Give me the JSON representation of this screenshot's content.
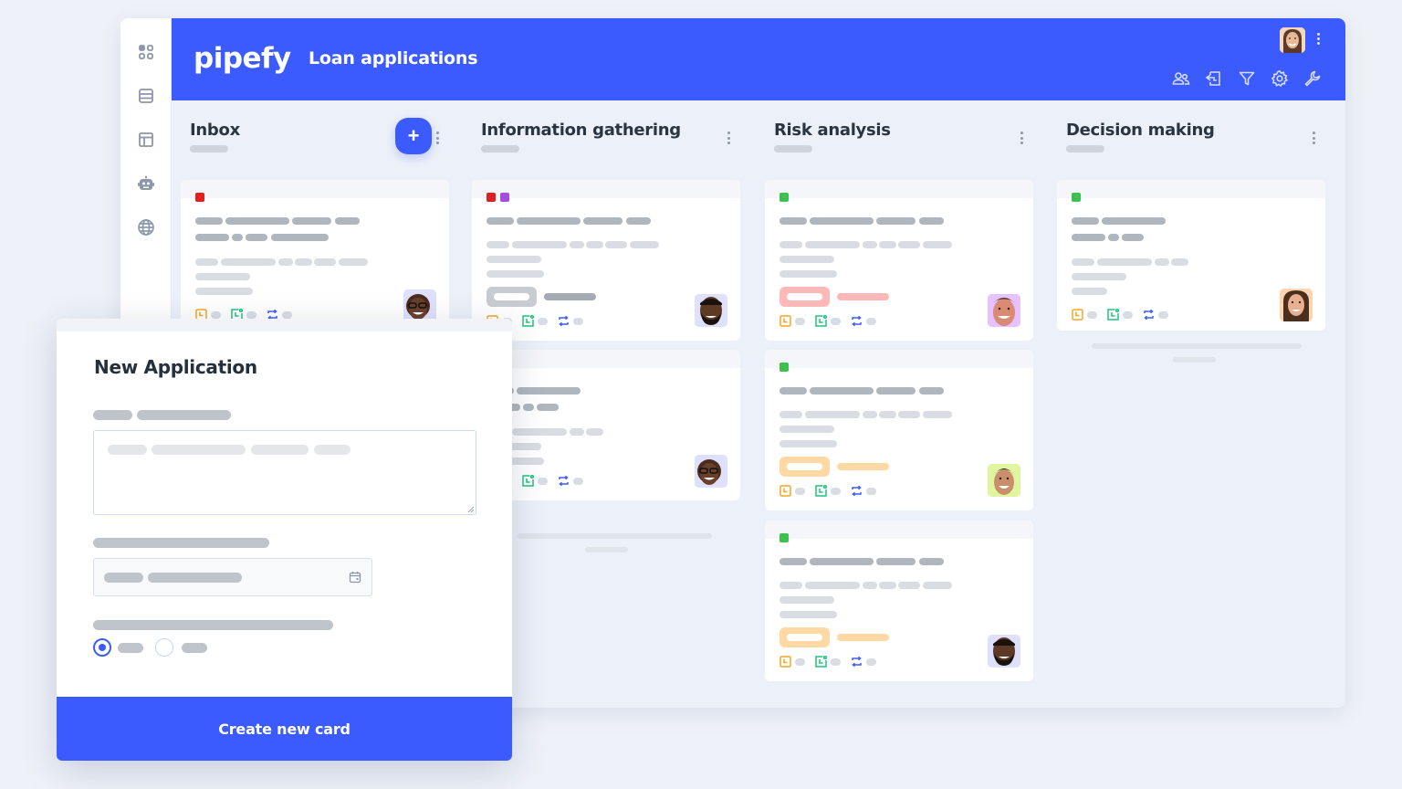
{
  "app": {
    "logo": "pipefy",
    "title": "Loan applications"
  },
  "sidebar": {
    "items": [
      {
        "icon": "dashboard-grid-icon",
        "label": "Dashboard"
      },
      {
        "icon": "database-icon",
        "label": "Databases"
      },
      {
        "icon": "layout-icon",
        "label": "Pipes"
      },
      {
        "icon": "robot-icon",
        "label": "Automations"
      },
      {
        "icon": "globe-icon",
        "label": "Portals"
      }
    ]
  },
  "topbar": {
    "user_avatar": "user-avatar",
    "more_icon": "vertical-dots-icon",
    "tools": [
      {
        "icon": "members-icon"
      },
      {
        "icon": "import-icon"
      },
      {
        "icon": "filter-icon"
      },
      {
        "icon": "settings-gear-icon"
      },
      {
        "icon": "wrench-icon"
      }
    ]
  },
  "board": {
    "columns": [
      {
        "title": "Inbox",
        "has_add_button": true,
        "add_label": "+",
        "cards": [
          {
            "labels": [
              "#e02020"
            ],
            "tag_color": null,
            "avatar": "woman-glasses"
          }
        ]
      },
      {
        "title": "Information gathering",
        "has_add_button": false,
        "cards": [
          {
            "labels": [
              "#e02020",
              "#a24ee2"
            ],
            "tag_color": "#c8ccd2",
            "avatar": "man-beard"
          },
          {
            "labels": [],
            "tag_color": null,
            "avatar": "woman-glasses"
          }
        ]
      },
      {
        "title": "Risk analysis",
        "has_add_button": false,
        "cards": [
          {
            "labels": [
              "#3ec04f"
            ],
            "tag_color": "#ffb8b8",
            "avatar": "man-smiling-pink"
          },
          {
            "labels": [
              "#3ec04f"
            ],
            "tag_color": "#ffd9a3",
            "avatar": "man-smiling-green"
          },
          {
            "labels": [
              "#3ec04f"
            ],
            "tag_color": "#ffd9a3",
            "avatar": "man-beard"
          }
        ]
      },
      {
        "title": "Decision making",
        "has_add_button": false,
        "cards": [
          {
            "labels": [
              "#3ec04f"
            ],
            "tag_color": null,
            "avatar": "woman-smiling"
          }
        ]
      }
    ],
    "card_meta_icons": [
      "due-date-clock-icon",
      "late-card-icon",
      "refresh-cycle-icon"
    ]
  },
  "modal": {
    "title": "New Application",
    "textarea_placeholder": "",
    "date_field_icon": "calendar-icon",
    "radio_options": [
      {
        "selected": true
      },
      {
        "selected": false
      }
    ],
    "submit_label": "Create new card"
  },
  "colors": {
    "brand": "#3c5bff",
    "background": "#eef1f8",
    "label_red": "#e02020",
    "label_purple": "#a24ee2",
    "label_green": "#3ec04f",
    "icon_orange": "#f5a623",
    "icon_green": "#1fc47d",
    "icon_blue": "#3c5bff"
  }
}
